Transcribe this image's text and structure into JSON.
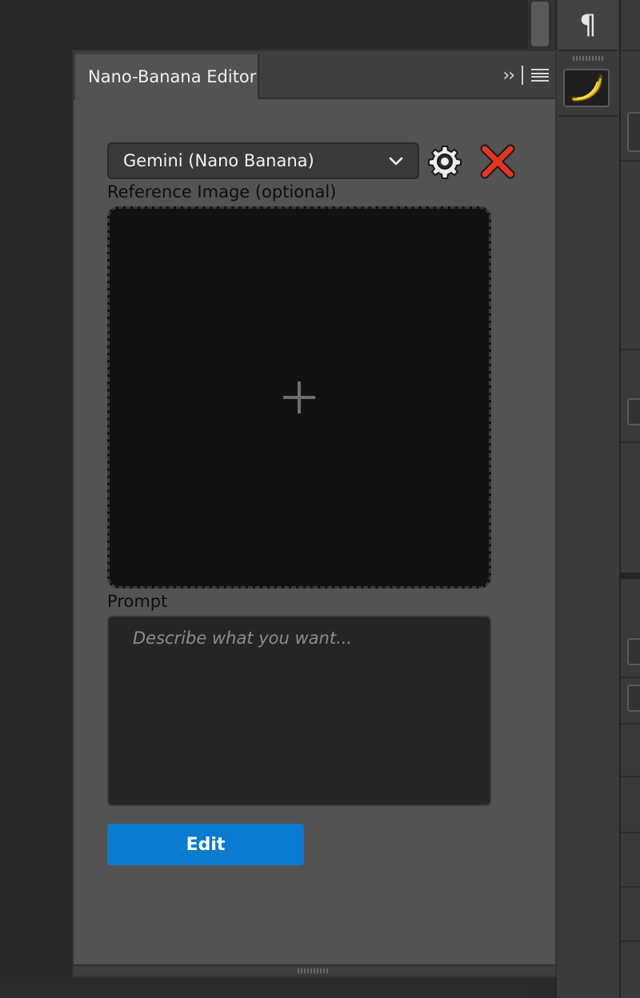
{
  "panel": {
    "tab_title": "Nano-Banana Editor",
    "collapse_icon": "double-chevron-right-icon",
    "menu_icon": "hamburger-menu-icon"
  },
  "model_select": {
    "value": "Gemini (Nano Banana)",
    "icon": "chevron-down-icon"
  },
  "actions": {
    "settings_icon": "gear-icon",
    "close_icon": "red-x-icon"
  },
  "reference": {
    "label": "Reference Image (optional)",
    "icon": "plus-icon"
  },
  "prompt": {
    "label": "Prompt",
    "placeholder": "Describe what you want...",
    "value": ""
  },
  "edit_button": {
    "label": "Edit"
  },
  "toolbar": {
    "paragraph_glyph": "¶",
    "banana_glyph": "🍌"
  },
  "colors": {
    "accent": "#0a7bcf",
    "close": "#e53520",
    "panel_bg": "#535353",
    "drop_zone_bg": "#121212"
  }
}
